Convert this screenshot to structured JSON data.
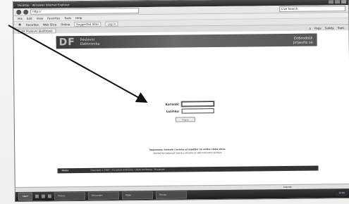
{
  "browser": {
    "title": "Desktop - Windows Internet Explorer",
    "url": "http://",
    "search_placeholder": "Live Search",
    "menu": [
      "File",
      "Edit",
      "View",
      "Favorites",
      "Tools",
      "Help"
    ],
    "favorites": [
      "Favorites",
      "Web Slice",
      "Online",
      "Suggested Sites",
      "Log in"
    ],
    "tab_title": "DF Poslovni Elektronik",
    "commands": [
      "Page",
      "Safety",
      "Tools"
    ]
  },
  "page": {
    "logo": "DF",
    "logo_sub_1": "Poslovni",
    "logo_sub_2": "Elektronika",
    "banner_right_1": "Dobrodošli",
    "banner_right_2": "prijavite se",
    "login": {
      "username_label": "Korisnik:",
      "password_label": "Lozinka:",
      "submit_label": "Prijava"
    },
    "notice_bold": "Napomena: korisnik i lozinka su osjetljivi na velika i mala slova.",
    "notice_line": "Ukoliko ste zaboravili lozinku, obratite se administratoru sustava.",
    "footer_home": "Home",
    "footer_text": "Copyright © 2010 · Sva prava pridržana · Uvjeti korištenja · Privatnost"
  },
  "status": {
    "zone": "Internet"
  },
  "taskbar": {
    "start": "start",
    "items": [
      "Prijava",
      "Dokument",
      "Mapa",
      "Poruka"
    ],
    "tray": "12:00"
  }
}
